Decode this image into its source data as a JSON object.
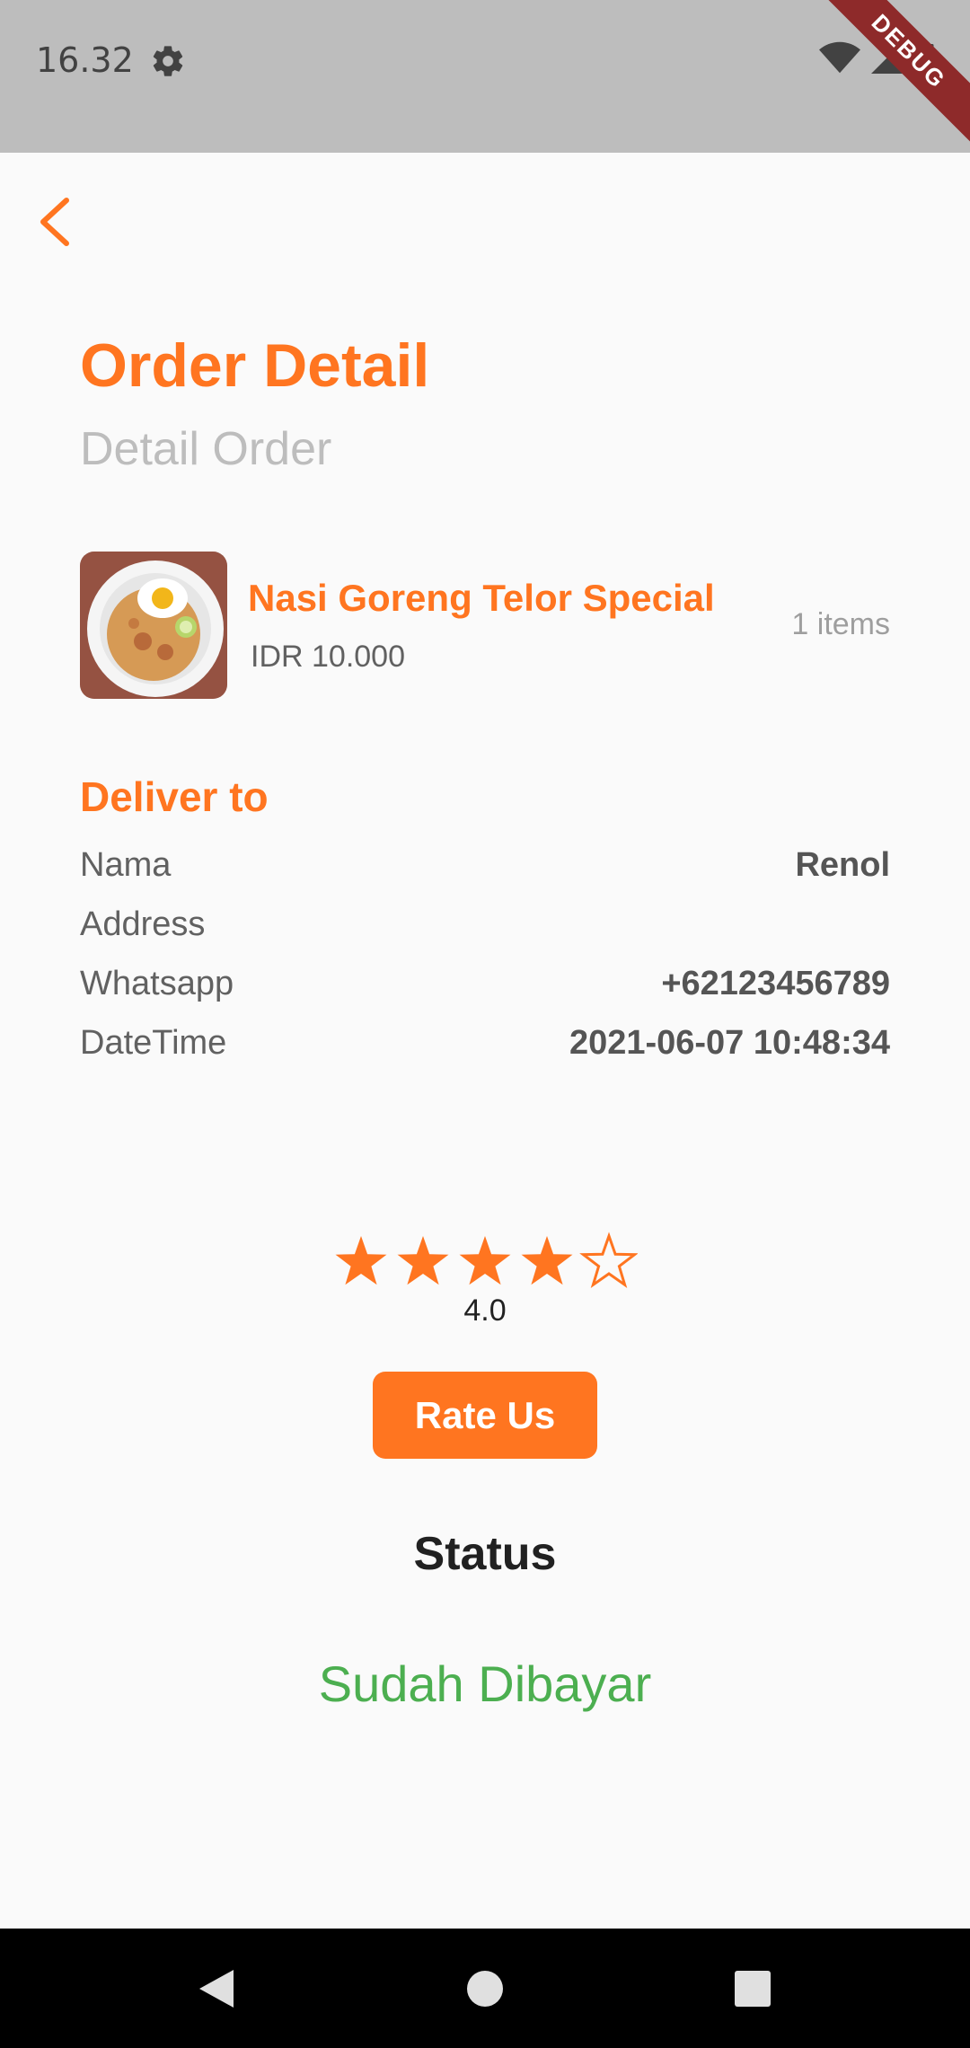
{
  "status_bar": {
    "time": "16.32",
    "debug_label": "DEBUG"
  },
  "header": {
    "title": "Order Detail",
    "subtitle": "Detail Order"
  },
  "order_item": {
    "name": "Nasi Goreng Telor Special",
    "price": "IDR 10.000",
    "quantity": "1 items"
  },
  "delivery": {
    "title": "Deliver to",
    "rows": [
      {
        "label": "Nama",
        "value": "Renol"
      },
      {
        "label": "Address",
        "value": ""
      },
      {
        "label": "Whatsapp",
        "value": "+62123456789"
      },
      {
        "label": "DateTime",
        "value": "2021-06-07 10:48:34"
      }
    ]
  },
  "rating": {
    "value_text": "4.0",
    "filled_stars": 4,
    "total_stars": 5
  },
  "rate_button": {
    "label": "Rate Us"
  },
  "status": {
    "title": "Status",
    "value": "Sudah Dibayar"
  },
  "colors": {
    "accent": "#ff7520",
    "status_paid": "#4caf50",
    "status_bar": "#bdbdbd"
  }
}
